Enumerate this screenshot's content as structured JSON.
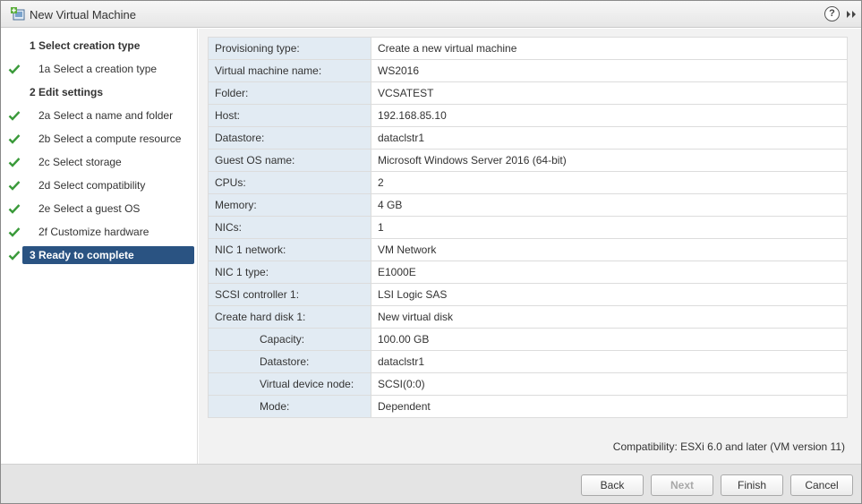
{
  "window": {
    "title": "New Virtual Machine",
    "help_label": "?"
  },
  "sidebar": {
    "steps": [
      {
        "label": "1  Select creation type",
        "checked": false,
        "header": true
      },
      {
        "label": "1a  Select a creation type",
        "checked": true,
        "header": false
      },
      {
        "label": "2  Edit settings",
        "checked": false,
        "header": true
      },
      {
        "label": "2a  Select a name and folder",
        "checked": true,
        "header": false
      },
      {
        "label": "2b  Select a compute resource",
        "checked": true,
        "header": false
      },
      {
        "label": "2c  Select storage",
        "checked": true,
        "header": false
      },
      {
        "label": "2d  Select compatibility",
        "checked": true,
        "header": false
      },
      {
        "label": "2e  Select a guest OS",
        "checked": true,
        "header": false
      },
      {
        "label": "2f  Customize hardware",
        "checked": true,
        "header": false
      },
      {
        "label": "3  Ready to complete",
        "checked": true,
        "header": true,
        "active": true
      }
    ]
  },
  "summary": {
    "rows": [
      {
        "key": "Provisioning type:",
        "value": "Create a new virtual machine",
        "sub": false
      },
      {
        "key": "Virtual machine name:",
        "value": "WS2016",
        "sub": false
      },
      {
        "key": "Folder:",
        "value": "VCSATEST",
        "sub": false
      },
      {
        "key": "Host:",
        "value": "192.168.85.10",
        "sub": false
      },
      {
        "key": "Datastore:",
        "value": "dataclstr1",
        "sub": false
      },
      {
        "key": "Guest OS name:",
        "value": "Microsoft Windows Server 2016 (64-bit)",
        "sub": false
      },
      {
        "key": "CPUs:",
        "value": "2",
        "sub": false
      },
      {
        "key": "Memory:",
        "value": "4 GB",
        "sub": false
      },
      {
        "key": "NICs:",
        "value": "1",
        "sub": false
      },
      {
        "key": "NIC 1 network:",
        "value": "VM Network",
        "sub": false
      },
      {
        "key": "NIC 1 type:",
        "value": "E1000E",
        "sub": false
      },
      {
        "key": "SCSI controller 1:",
        "value": "LSI Logic SAS",
        "sub": false
      },
      {
        "key": "Create hard disk 1:",
        "value": "New virtual disk",
        "sub": false
      },
      {
        "key": "Capacity:",
        "value": "100.00 GB",
        "sub": true
      },
      {
        "key": "Datastore:",
        "value": "dataclstr1",
        "sub": true
      },
      {
        "key": "Virtual device node:",
        "value": "SCSI(0:0)",
        "sub": true
      },
      {
        "key": "Mode:",
        "value": "Dependent",
        "sub": true
      }
    ]
  },
  "compatibility": "Compatibility: ESXi 6.0 and later (VM version 11)",
  "footer": {
    "back_label": "Back",
    "next_label": "Next",
    "finish_label": "Finish",
    "cancel_label": "Cancel"
  },
  "colors": {
    "active_step": "#2a5382",
    "check_green": "#3a9a3a",
    "key_cell_bg": "#e2ebf3"
  },
  "icons": {
    "title": "new-vm-icon",
    "collapse": "double-chevron-right-icon",
    "step_done": "checkmark-icon"
  }
}
